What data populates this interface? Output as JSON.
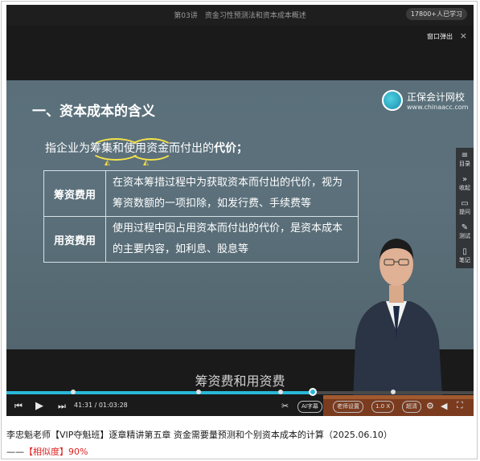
{
  "window": {
    "lesson_title": "第03讲　资金习性预测法和资本成本概述",
    "viewers": "17800+人已学习",
    "popout_label": "窗口弹出",
    "popout_close": "×"
  },
  "slide": {
    "heading": "一、资本成本的含义",
    "brand_name": "正保会计网校",
    "brand_url": "www.chinaacc.com",
    "intro_text": "指企业为筹集和使用资金而付出的",
    "intro_bold": "代价；",
    "rows": [
      {
        "head": "筹资费用",
        "body": "在资本筹措过程中为获取资本而付出的代价，视为筹资数额的一项扣除，如发行费、手续费等"
      },
      {
        "head": "用资费用",
        "body": "使用过程中因占用资本而付出的代价，是资本成本的主要内容，如利息、股息等"
      }
    ]
  },
  "sidepanel": [
    {
      "icon": "≡",
      "label": "目录"
    },
    {
      "icon": "»",
      "label": "收起"
    },
    {
      "icon": "▭",
      "label": "提问"
    },
    {
      "icon": "✎",
      "label": "测试"
    },
    {
      "icon": "▯",
      "label": "笔记"
    }
  ],
  "subtitle": "筹资费和用资费",
  "progress": {
    "played_fraction": 0.655,
    "accent": "#29b8d8"
  },
  "controls": {
    "time": "41:31 / 01:03:28",
    "ai_subtitle": "AI字幕",
    "teacher_setting": "老师设置",
    "speed": "1.0 X",
    "quality": "超清"
  },
  "caption": {
    "line1": "李忠魁老师【VIP夺魁班】逐章精讲第五章 资金需要量预测和个别资本成本的计算（2025.06.10）",
    "line2_prefix": "——",
    "line2_similarity": "【相似度】90%"
  }
}
